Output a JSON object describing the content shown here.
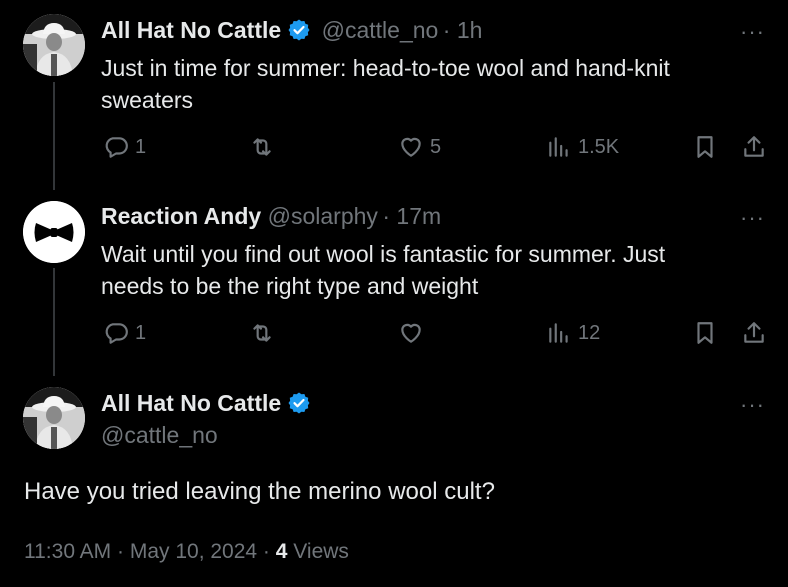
{
  "tweet1": {
    "name": "All Hat No Cattle",
    "handle": "@cattle_no",
    "time": "· 1h",
    "text_line1": "Just in time for summer: head-to-toe wool and hand-knit",
    "text_line2": "sweaters",
    "replies": "1",
    "retweets": "",
    "likes": "5",
    "views": "1.5K",
    "verified": true,
    "verified_color": "#1d9bf0"
  },
  "tweet2": {
    "name": "Reaction Andy",
    "handle": "@solarphy",
    "time": "· 17m",
    "text_line1": "Wait until you find out wool is fantastic for summer. Just",
    "text_line2": "needs to be the right type and weight",
    "replies": "1",
    "retweets": "",
    "likes": "",
    "views": "12"
  },
  "main_tweet": {
    "name": "All Hat No Cattle",
    "handle": "@cattle_no",
    "text": "Have you tried leaving the merino wool cult?",
    "timestamp": "11:30 AM · May 10, 2024 ·",
    "views_count": "4",
    "views_label": "Views",
    "verified": true
  },
  "icons": {
    "reply": "reply-icon",
    "retweet": "retweet-icon",
    "like": "heart-icon",
    "views": "views-icon",
    "bookmark": "bookmark-icon",
    "share": "share-icon",
    "more": "more-icon",
    "verified": "verified-badge-icon"
  },
  "more_glyph": "···"
}
